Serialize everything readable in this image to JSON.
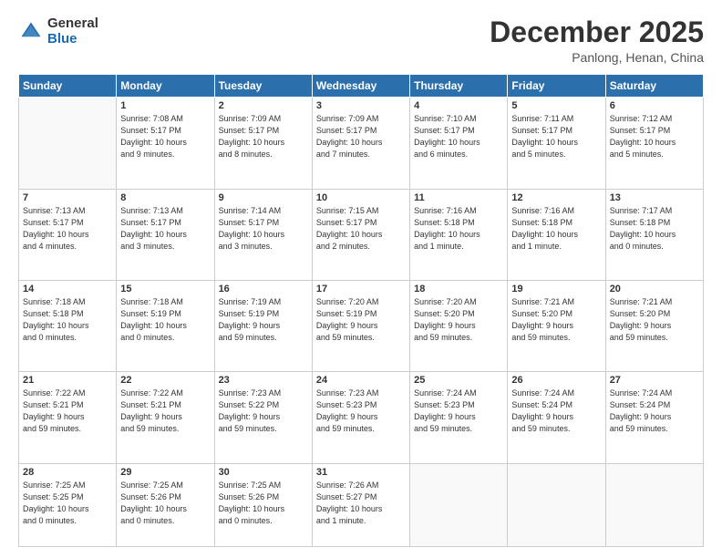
{
  "logo": {
    "general": "General",
    "blue": "Blue"
  },
  "header": {
    "month": "December 2025",
    "location": "Panlong, Henan, China"
  },
  "weekdays": [
    "Sunday",
    "Monday",
    "Tuesday",
    "Wednesday",
    "Thursday",
    "Friday",
    "Saturday"
  ],
  "weeks": [
    [
      {
        "day": "",
        "info": ""
      },
      {
        "day": "1",
        "info": "Sunrise: 7:08 AM\nSunset: 5:17 PM\nDaylight: 10 hours\nand 9 minutes."
      },
      {
        "day": "2",
        "info": "Sunrise: 7:09 AM\nSunset: 5:17 PM\nDaylight: 10 hours\nand 8 minutes."
      },
      {
        "day": "3",
        "info": "Sunrise: 7:09 AM\nSunset: 5:17 PM\nDaylight: 10 hours\nand 7 minutes."
      },
      {
        "day": "4",
        "info": "Sunrise: 7:10 AM\nSunset: 5:17 PM\nDaylight: 10 hours\nand 6 minutes."
      },
      {
        "day": "5",
        "info": "Sunrise: 7:11 AM\nSunset: 5:17 PM\nDaylight: 10 hours\nand 5 minutes."
      },
      {
        "day": "6",
        "info": "Sunrise: 7:12 AM\nSunset: 5:17 PM\nDaylight: 10 hours\nand 5 minutes."
      }
    ],
    [
      {
        "day": "7",
        "info": "Sunrise: 7:13 AM\nSunset: 5:17 PM\nDaylight: 10 hours\nand 4 minutes."
      },
      {
        "day": "8",
        "info": "Sunrise: 7:13 AM\nSunset: 5:17 PM\nDaylight: 10 hours\nand 3 minutes."
      },
      {
        "day": "9",
        "info": "Sunrise: 7:14 AM\nSunset: 5:17 PM\nDaylight: 10 hours\nand 3 minutes."
      },
      {
        "day": "10",
        "info": "Sunrise: 7:15 AM\nSunset: 5:17 PM\nDaylight: 10 hours\nand 2 minutes."
      },
      {
        "day": "11",
        "info": "Sunrise: 7:16 AM\nSunset: 5:18 PM\nDaylight: 10 hours\nand 1 minute."
      },
      {
        "day": "12",
        "info": "Sunrise: 7:16 AM\nSunset: 5:18 PM\nDaylight: 10 hours\nand 1 minute."
      },
      {
        "day": "13",
        "info": "Sunrise: 7:17 AM\nSunset: 5:18 PM\nDaylight: 10 hours\nand 0 minutes."
      }
    ],
    [
      {
        "day": "14",
        "info": "Sunrise: 7:18 AM\nSunset: 5:18 PM\nDaylight: 10 hours\nand 0 minutes."
      },
      {
        "day": "15",
        "info": "Sunrise: 7:18 AM\nSunset: 5:19 PM\nDaylight: 10 hours\nand 0 minutes."
      },
      {
        "day": "16",
        "info": "Sunrise: 7:19 AM\nSunset: 5:19 PM\nDaylight: 9 hours\nand 59 minutes."
      },
      {
        "day": "17",
        "info": "Sunrise: 7:20 AM\nSunset: 5:19 PM\nDaylight: 9 hours\nand 59 minutes."
      },
      {
        "day": "18",
        "info": "Sunrise: 7:20 AM\nSunset: 5:20 PM\nDaylight: 9 hours\nand 59 minutes."
      },
      {
        "day": "19",
        "info": "Sunrise: 7:21 AM\nSunset: 5:20 PM\nDaylight: 9 hours\nand 59 minutes."
      },
      {
        "day": "20",
        "info": "Sunrise: 7:21 AM\nSunset: 5:20 PM\nDaylight: 9 hours\nand 59 minutes."
      }
    ],
    [
      {
        "day": "21",
        "info": "Sunrise: 7:22 AM\nSunset: 5:21 PM\nDaylight: 9 hours\nand 59 minutes."
      },
      {
        "day": "22",
        "info": "Sunrise: 7:22 AM\nSunset: 5:21 PM\nDaylight: 9 hours\nand 59 minutes."
      },
      {
        "day": "23",
        "info": "Sunrise: 7:23 AM\nSunset: 5:22 PM\nDaylight: 9 hours\nand 59 minutes."
      },
      {
        "day": "24",
        "info": "Sunrise: 7:23 AM\nSunset: 5:23 PM\nDaylight: 9 hours\nand 59 minutes."
      },
      {
        "day": "25",
        "info": "Sunrise: 7:24 AM\nSunset: 5:23 PM\nDaylight: 9 hours\nand 59 minutes."
      },
      {
        "day": "26",
        "info": "Sunrise: 7:24 AM\nSunset: 5:24 PM\nDaylight: 9 hours\nand 59 minutes."
      },
      {
        "day": "27",
        "info": "Sunrise: 7:24 AM\nSunset: 5:24 PM\nDaylight: 9 hours\nand 59 minutes."
      }
    ],
    [
      {
        "day": "28",
        "info": "Sunrise: 7:25 AM\nSunset: 5:25 PM\nDaylight: 10 hours\nand 0 minutes."
      },
      {
        "day": "29",
        "info": "Sunrise: 7:25 AM\nSunset: 5:26 PM\nDaylight: 10 hours\nand 0 minutes."
      },
      {
        "day": "30",
        "info": "Sunrise: 7:25 AM\nSunset: 5:26 PM\nDaylight: 10 hours\nand 0 minutes."
      },
      {
        "day": "31",
        "info": "Sunrise: 7:26 AM\nSunset: 5:27 PM\nDaylight: 10 hours\nand 1 minute."
      },
      {
        "day": "",
        "info": ""
      },
      {
        "day": "",
        "info": ""
      },
      {
        "day": "",
        "info": ""
      }
    ]
  ]
}
